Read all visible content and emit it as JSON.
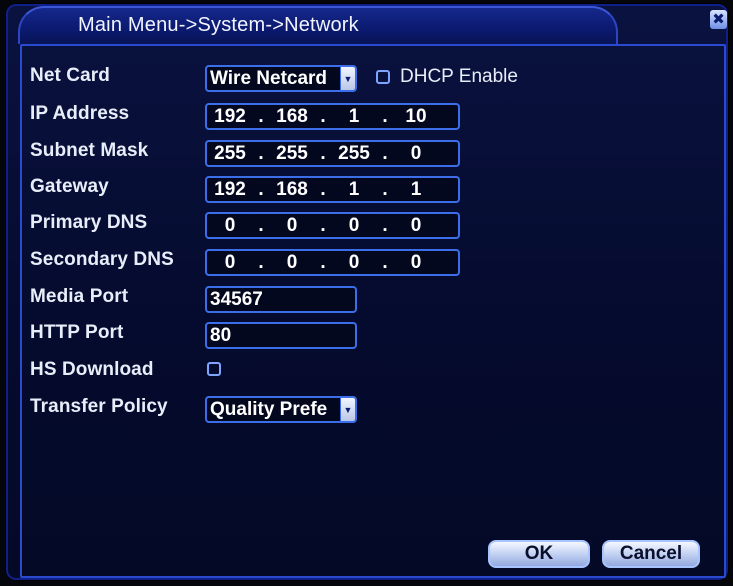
{
  "window": {
    "title": "Main Menu->System->Network",
    "close_glyph": "✖"
  },
  "net_card": {
    "label": "Net Card",
    "value": "Wire Netcard",
    "dhcp_label": "DHCP Enable",
    "dhcp_checked": false
  },
  "ip_address": {
    "label": "IP Address",
    "octets": [
      "192",
      "168",
      "1",
      "10"
    ]
  },
  "subnet_mask": {
    "label": "Subnet Mask",
    "octets": [
      "255",
      "255",
      "255",
      "0"
    ]
  },
  "gateway": {
    "label": "Gateway",
    "octets": [
      "192",
      "168",
      "1",
      "1"
    ]
  },
  "primary_dns": {
    "label": "Primary DNS",
    "octets": [
      "0",
      "0",
      "0",
      "0"
    ]
  },
  "secondary_dns": {
    "label": "Secondary DNS",
    "octets": [
      "0",
      "0",
      "0",
      "0"
    ]
  },
  "media_port": {
    "label": "Media Port",
    "value": "34567"
  },
  "http_port": {
    "label": "HTTP Port",
    "value": "80"
  },
  "hs_download": {
    "label": "HS Download",
    "checked": false
  },
  "transfer_policy": {
    "label": "Transfer Policy",
    "value": "Quality Prefe"
  },
  "buttons": {
    "ok": "OK",
    "cancel": "Cancel"
  },
  "colors": {
    "accent": "#3b6ee8",
    "background": "#050b2e",
    "title_bar": "#0b1a6e"
  },
  "icons": {
    "close": "close-icon",
    "dropdown": "chevron-down-icon"
  }
}
